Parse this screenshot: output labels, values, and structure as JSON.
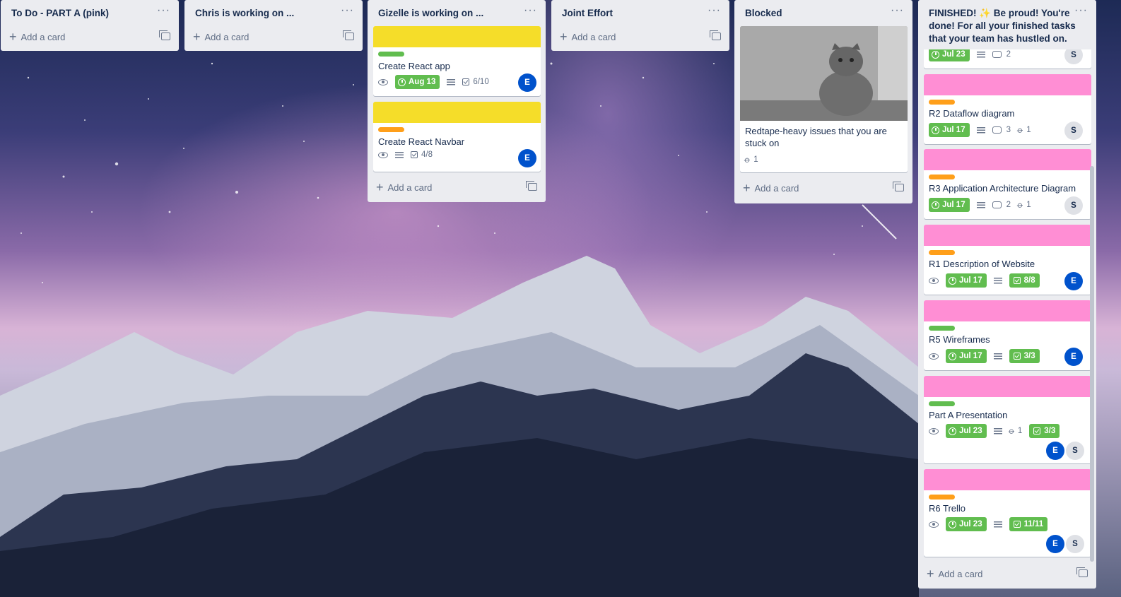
{
  "board": {
    "add_card_label": "Add a card",
    "menu_glyph": "···",
    "lists": [
      {
        "title": "To Do - PART A (pink)"
      },
      {
        "title": "Chris is working on ..."
      },
      {
        "title": "Gizelle is working on ..."
      },
      {
        "title": "Joint Effort"
      },
      {
        "title": "Blocked"
      },
      {
        "title": "FINISHED! ✨ Be proud! You're done! For all your finished tasks that your team has hustled on."
      }
    ]
  },
  "colors": {
    "cover_yellow": "#f5dd29",
    "cover_pink": "#ff8ed4",
    "label_green": "#61bd4f",
    "label_orange": "#ff9f1a",
    "due_complete": "#61bd4f",
    "avatar_e": "#0052cc",
    "avatar_s": "#dfe1e6"
  },
  "gizelle_cards": [
    {
      "title": "Create React app",
      "due": "Aug 13",
      "checklist": "6/10",
      "member": "E"
    },
    {
      "title": "Create React Navbar",
      "checklist": "4/8",
      "member": "E"
    }
  ],
  "blocked_card": {
    "title": "Redtape-heavy issues that you are stuck on",
    "attachments": "1"
  },
  "finished_cards": [
    {
      "title": "",
      "due": "Jul 23",
      "comments": "2",
      "member": "S"
    },
    {
      "title": "R2 Dataflow diagram",
      "due": "Jul 17",
      "comments": "3",
      "attachments": "1",
      "member": "S"
    },
    {
      "title": "R3 Application Architecture Diagram",
      "due": "Jul 17",
      "comments": "2",
      "attachments": "1",
      "member": "S"
    },
    {
      "title": "R1 Description of Website",
      "due": "Jul 17",
      "checklist": "8/8",
      "member": "E"
    },
    {
      "title": "R5 Wireframes",
      "due": "Jul 17",
      "checklist": "3/3",
      "member": "E"
    },
    {
      "title": "Part A Presentation",
      "due": "Jul 23",
      "attachments": "1",
      "checklist": "3/3",
      "members": [
        "E",
        "S"
      ]
    },
    {
      "title": "R6 Trello",
      "due": "Jul 23",
      "checklist": "11/11",
      "members": [
        "E",
        "S"
      ]
    }
  ]
}
